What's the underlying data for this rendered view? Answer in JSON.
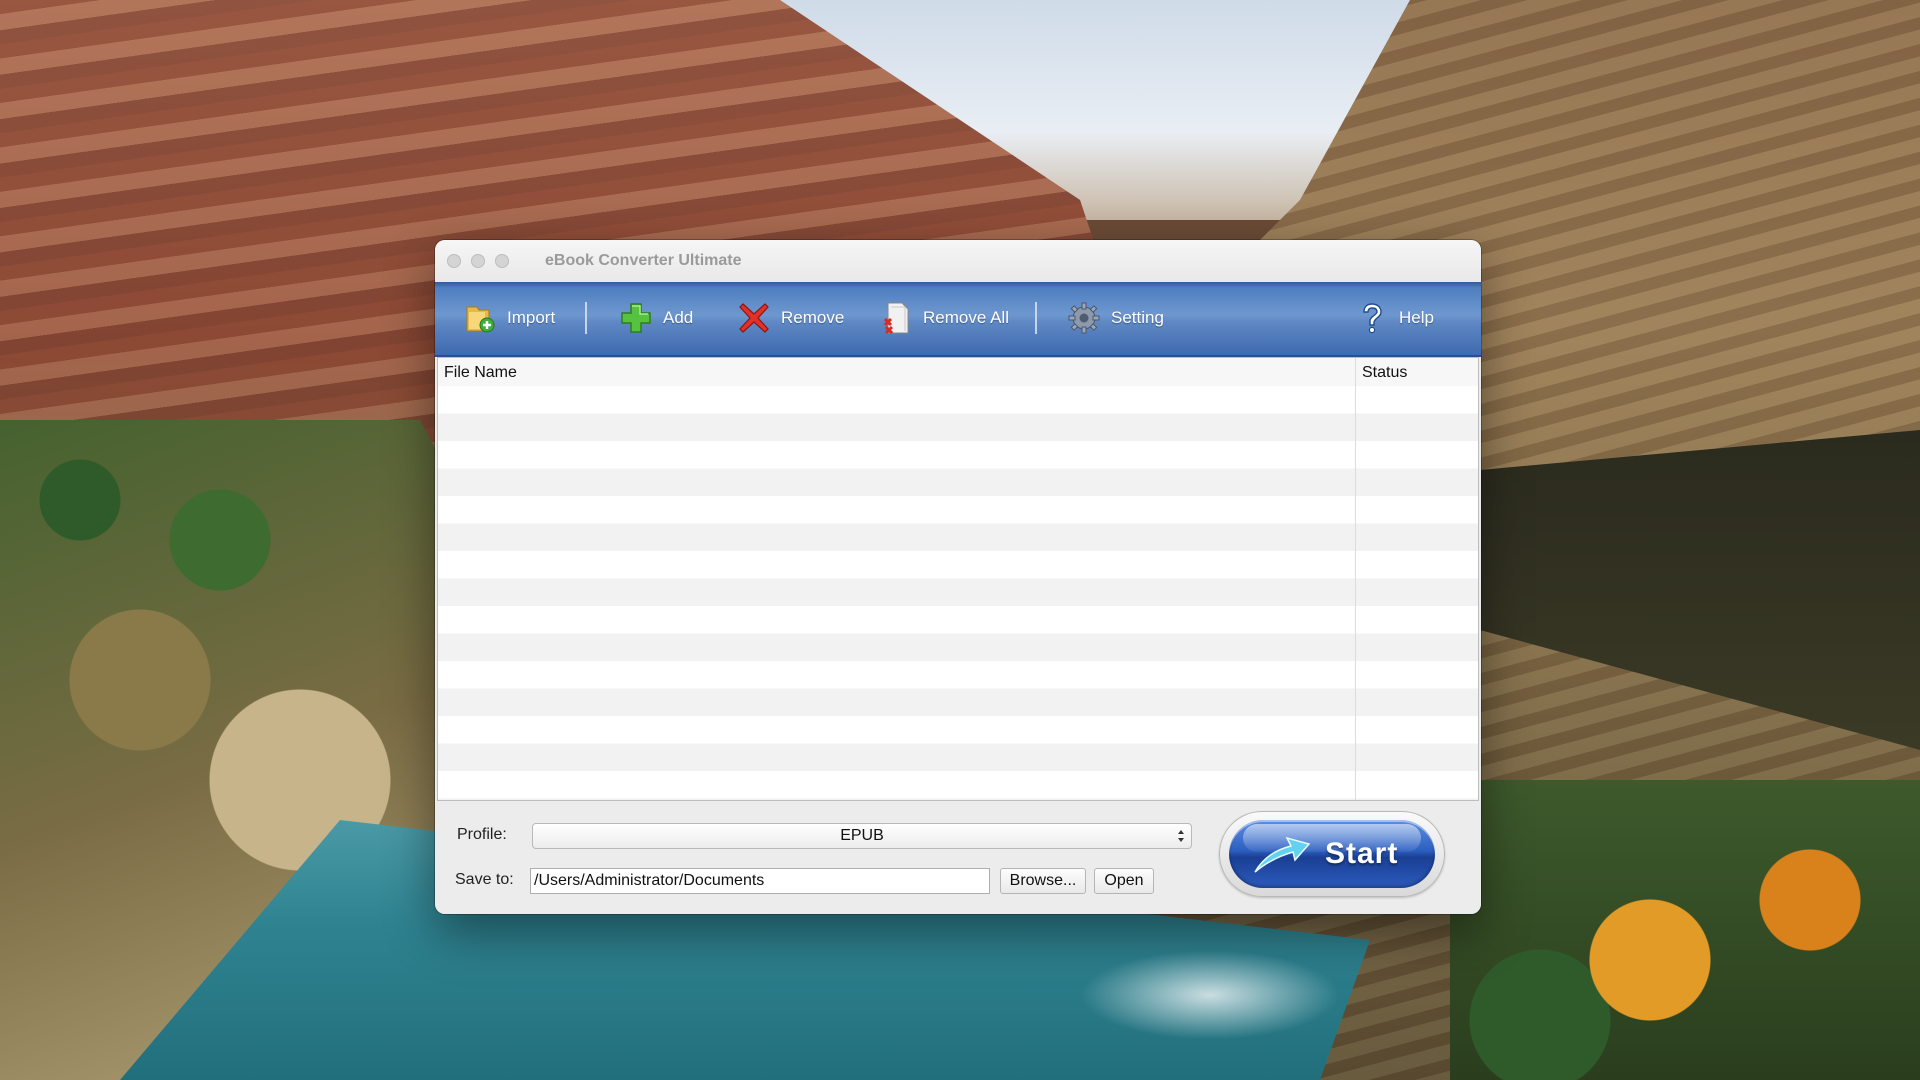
{
  "window": {
    "title": "eBook Converter Ultimate"
  },
  "toolbar": {
    "import_label": "Import",
    "add_label": "Add",
    "remove_label": "Remove",
    "remove_all_label": "Remove All",
    "setting_label": "Setting",
    "help_label": "Help"
  },
  "table": {
    "columns": [
      "File Name",
      "Status"
    ],
    "rows": []
  },
  "profile": {
    "label": "Profile:",
    "selected": "EPUB"
  },
  "save_to": {
    "label": "Save to:",
    "value": "/Users/Administrator/Documents",
    "browse_label": "Browse...",
    "open_label": "Open"
  },
  "start": {
    "label": "Start"
  },
  "colors": {
    "toolbar_blue": "#4f7fc0",
    "start_blue": "#2d5fc0"
  }
}
